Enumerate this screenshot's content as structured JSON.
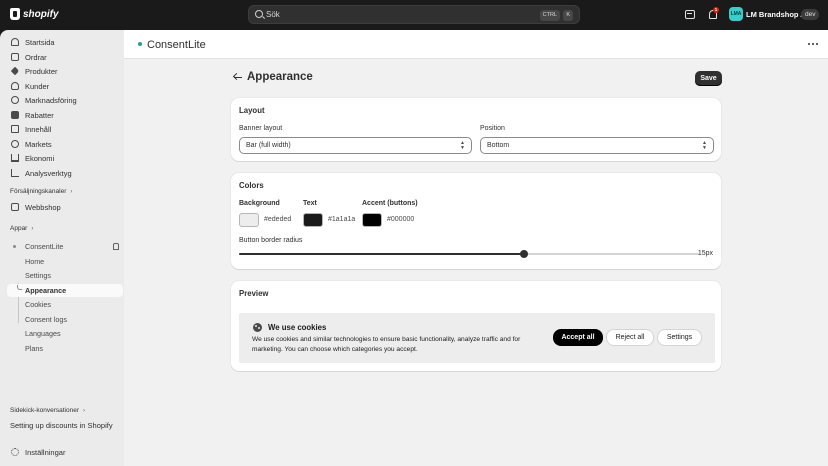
{
  "topbar": {
    "logo_text": "shopify",
    "search_placeholder": "Sök",
    "kbd_ctrl": "CTRL",
    "kbd_k": "K",
    "notification_count": "1",
    "avatar_initials": "LMA",
    "shop_name": "LM Brandshop AB",
    "env_badge": "dev"
  },
  "sidebar": {
    "items": [
      {
        "label": "Startsida",
        "icon": "home-icon"
      },
      {
        "label": "Ordrar",
        "icon": "order-icon"
      },
      {
        "label": "Produkter",
        "icon": "tag-icon"
      },
      {
        "label": "Kunder",
        "icon": "person-icon"
      },
      {
        "label": "Marknadsföring",
        "icon": "target-icon"
      },
      {
        "label": "Rabatter",
        "icon": "discount-icon"
      },
      {
        "label": "Innehåll",
        "icon": "content-icon"
      },
      {
        "label": "Markets",
        "icon": "globe-icon"
      },
      {
        "label": "Ekonomi",
        "icon": "bank-icon"
      },
      {
        "label": "Analysverktyg",
        "icon": "chart-icon"
      }
    ],
    "sales_channels_label": "Försäljningskanaler",
    "sales_channels": [
      {
        "label": "Webbshop",
        "icon": "store-icon"
      }
    ],
    "apps_label": "Appar",
    "app_name": "ConsentLite",
    "app_subitems": [
      "Home",
      "Settings",
      "Appearance",
      "Cookies",
      "Consent logs",
      "Languages",
      "Plans"
    ],
    "active_subitem": "Appearance",
    "sidekick_label": "Sidekick-konversationer",
    "sidekick_task": "Setting up discounts in Shopify",
    "settings_label": "Inställningar"
  },
  "app_header": {
    "title": "ConsentLite"
  },
  "page": {
    "title": "Appearance",
    "save_label": "Save"
  },
  "layout_card": {
    "title": "Layout",
    "banner_layout_label": "Banner layout",
    "banner_layout_value": "Bar (full width)",
    "position_label": "Position",
    "position_value": "Bottom"
  },
  "colors_card": {
    "title": "Colors",
    "background_label": "Background",
    "background_value": "#ededed",
    "text_label": "Text",
    "text_value": "#1a1a1a",
    "accent_label": "Accent (buttons)",
    "accent_value": "#000000",
    "radius_label": "Button border radius",
    "radius_value": "15px",
    "radius_fraction": 0.62
  },
  "preview_card": {
    "title": "Preview",
    "banner_title": "We use cookies",
    "banner_text": "We use cookies and similar technologies to ensure basic functionality, analyze traffic and for marketing. You can choose which categories you accept.",
    "accept_label": "Accept all",
    "reject_label": "Reject all",
    "settings_label": "Settings"
  },
  "colors": {
    "topbar_bg": "#1a1a1a",
    "sidebar_bg": "#ebebeb",
    "main_bg": "#f1f1f1",
    "primary_button": "#303030",
    "notification": "#e51c00",
    "avatar_bg": "#36cfc9"
  }
}
